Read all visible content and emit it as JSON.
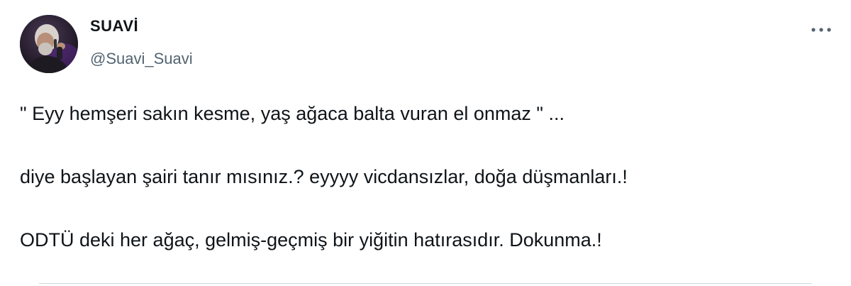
{
  "author": {
    "display_name": "SUAVİ",
    "handle": "@Suavi_Suavi",
    "avatar_icon": "profile-photo"
  },
  "more_icon": "ellipsis-icon",
  "tweet": {
    "paragraphs": [
      "\" Eyy hemşeri sakın kesme, yaş ağaca balta vuran el onmaz \" ...",
      "diye başlayan şairi tanır mısınız.? eyyyy vicdansızlar, doğa düşmanları.!",
      "ODTÜ deki her ağaç, gelmiş-geçmiş bir yiğitin hatırasıdır. Dokunma.!"
    ]
  },
  "colors": {
    "text": "#0f1419",
    "secondary": "#536471",
    "divider": "#cfd9de"
  }
}
